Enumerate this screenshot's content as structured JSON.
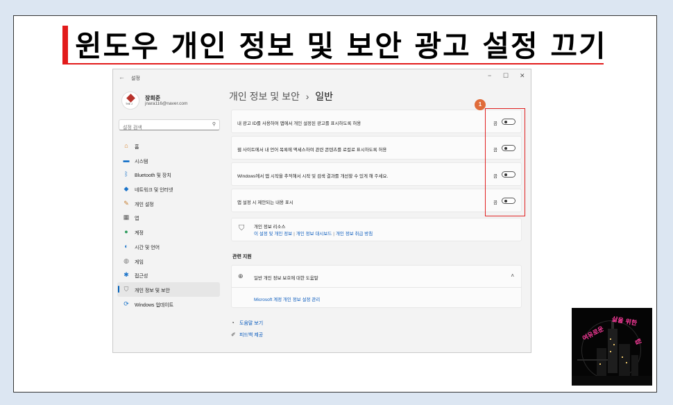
{
  "slide": {
    "title": "윈도우 개인 정보 및 보안 광고 설정 끄기"
  },
  "window": {
    "app_title": "설정",
    "controls": {
      "minimize": "−",
      "maximize": "☐",
      "close": "✕"
    },
    "back_glyph": "←"
  },
  "profile": {
    "name": "장희준",
    "email": "jnara116@naver.com",
    "avatar_text": "THE J"
  },
  "search": {
    "placeholder": "설정 검색",
    "icon": "search-icon"
  },
  "nav": {
    "items": [
      {
        "label": "홈",
        "icon": "home-icon",
        "glyph": "⌂",
        "color": "#d9822b"
      },
      {
        "label": "시스템",
        "icon": "monitor-icon",
        "glyph": "▬",
        "color": "#1a73c9"
      },
      {
        "label": "Bluetooth 및 장치",
        "icon": "bluetooth-icon",
        "glyph": "ᛒ",
        "color": "#1a73c9"
      },
      {
        "label": "네트워크 및 인터넷",
        "icon": "wifi-icon",
        "glyph": "◆",
        "color": "#1a73c9"
      },
      {
        "label": "개인 설정",
        "icon": "brush-icon",
        "glyph": "✎",
        "color": "#c47a2a"
      },
      {
        "label": "앱",
        "icon": "apps-icon",
        "glyph": "▦",
        "color": "#555555"
      },
      {
        "label": "계정",
        "icon": "account-icon",
        "glyph": "●",
        "color": "#2a9a5a"
      },
      {
        "label": "시간 및 언어",
        "icon": "clock-globe-icon",
        "glyph": "◐",
        "color": "#1a73c9"
      },
      {
        "label": "게임",
        "icon": "gamepad-icon",
        "glyph": "◍",
        "color": "#777777"
      },
      {
        "label": "접근성",
        "icon": "accessibility-icon",
        "glyph": "✱",
        "color": "#1a73c9"
      },
      {
        "label": "개인 정보 및 보안",
        "icon": "shield-icon",
        "glyph": "⛉",
        "color": "#777777",
        "active": true
      },
      {
        "label": "Windows 업데이트",
        "icon": "update-icon",
        "glyph": "⟳",
        "color": "#1a73c9"
      }
    ]
  },
  "page": {
    "breadcrumb_parent": "개인 정보 및 보안",
    "breadcrumb_sep": "›",
    "breadcrumb_current": "일반"
  },
  "settings": [
    {
      "label": "내 광고 ID를 사용하여 앱에서 개인 설정된 광고를 표시하도록 허용",
      "state": "끔"
    },
    {
      "label": "웹 사이트에서 내 언어 목록에 액세스하여 관련 콘텐츠를 로컬로 표시하도록 허용",
      "state": "끔"
    },
    {
      "label": "Windows에서 앱 시작을 추적해서 시작 및 검색 결과를 개선할 수 있게 해 주세요.",
      "state": "끔"
    },
    {
      "label": "앱 설정 시 제안되는 내용 표시",
      "state": "끔"
    }
  ],
  "annotation": {
    "badge": "1"
  },
  "resources": {
    "title": "개인 정보 리소스",
    "links": [
      "이 설정 및 개인 정보",
      "개인 정보 대시보드",
      "개인 정보 취급 방침"
    ],
    "separator": "|"
  },
  "related": {
    "heading": "관련 지원",
    "help_label": "일반 개인 정보 보호에 대한 도움말",
    "ms_link": "Microsoft 계정 개인 정보 설정 관리"
  },
  "bottom_links": [
    {
      "label": "도움말 보기",
      "icon": "help-icon",
      "glyph": "◔"
    },
    {
      "label": "피드백 제공",
      "icon": "feedback-icon",
      "glyph": "✐"
    }
  ],
  "colors": {
    "accent": "#005fb8",
    "annotation_red": "#e02020",
    "title_red": "#e21b1b",
    "link_blue": "#0a5bbd"
  }
}
